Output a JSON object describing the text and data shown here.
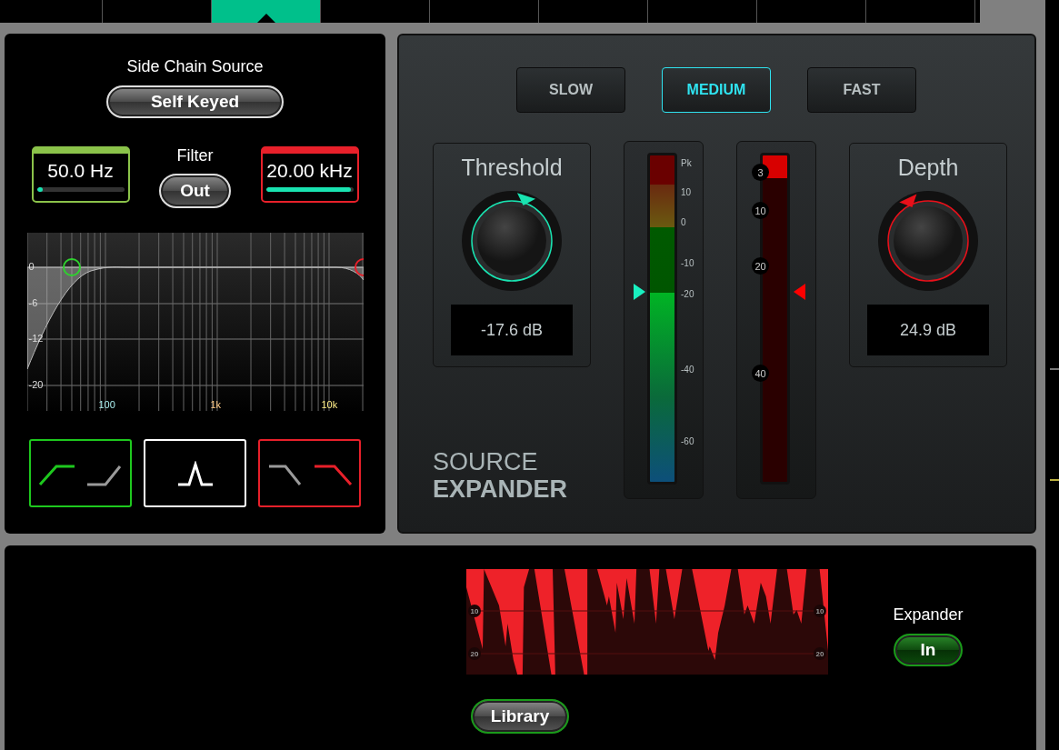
{
  "top_tabs": [
    {
      "selected": false
    },
    {
      "selected": false
    },
    {
      "selected": true
    },
    {
      "selected": false
    },
    {
      "selected": false
    },
    {
      "selected": false
    },
    {
      "selected": false
    },
    {
      "selected": false
    },
    {
      "selected": false
    }
  ],
  "side_chain": {
    "title": "Side Chain Source",
    "source_button": "Self Keyed",
    "low_filter": {
      "value": "50.0 Hz",
      "level": 0.07,
      "color": "#8bc34a"
    },
    "filter_label": "Filter",
    "filter_button": "Out",
    "high_filter": {
      "value": "20.00 kHz",
      "level": 0.97,
      "color": "#e8202a"
    },
    "eq_graph": {
      "y_labels": [
        "0",
        "-6",
        "-12",
        "-20"
      ],
      "x_labels": [
        "100",
        "1k",
        "10k"
      ]
    },
    "filter_types": [
      {
        "kind": "highpass",
        "color": "#1ec81e"
      },
      {
        "kind": "bandpass",
        "color": "#ffffff"
      },
      {
        "kind": "lowpass",
        "color": "#e8202a"
      }
    ]
  },
  "expander": {
    "speed_buttons": [
      {
        "label": "SLOW",
        "selected": false
      },
      {
        "label": "MEDIUM",
        "selected": true
      },
      {
        "label": "FAST",
        "selected": false
      }
    ],
    "threshold": {
      "label": "Threshold",
      "level": 0.63,
      "value": "-17.6 dB"
    },
    "input_meter": {
      "level": 0.58,
      "marker": {
        "level": 0.58
      },
      "scale": [
        "Pk",
        "10",
        "0",
        "-10",
        "-20",
        "-40",
        "-60"
      ]
    },
    "gain_reduction_meter": {
      "level": 0.07,
      "marker": {
        "level": 0.58
      },
      "scale": [
        "3",
        "10",
        "20",
        "40"
      ]
    },
    "depth": {
      "label": "Depth",
      "level": 0.32,
      "value": "24.9 dB"
    },
    "title_line_1": "SOURCE",
    "title_line_2": "EXPANDER"
  },
  "bottom": {
    "history_graph": {
      "left_labels": [
        "10",
        "20"
      ],
      "right_labels": [
        "10",
        "20"
      ]
    },
    "library_button": "Library",
    "expander_label": "Expander",
    "expander_button": {
      "label": "In",
      "on": true
    }
  }
}
